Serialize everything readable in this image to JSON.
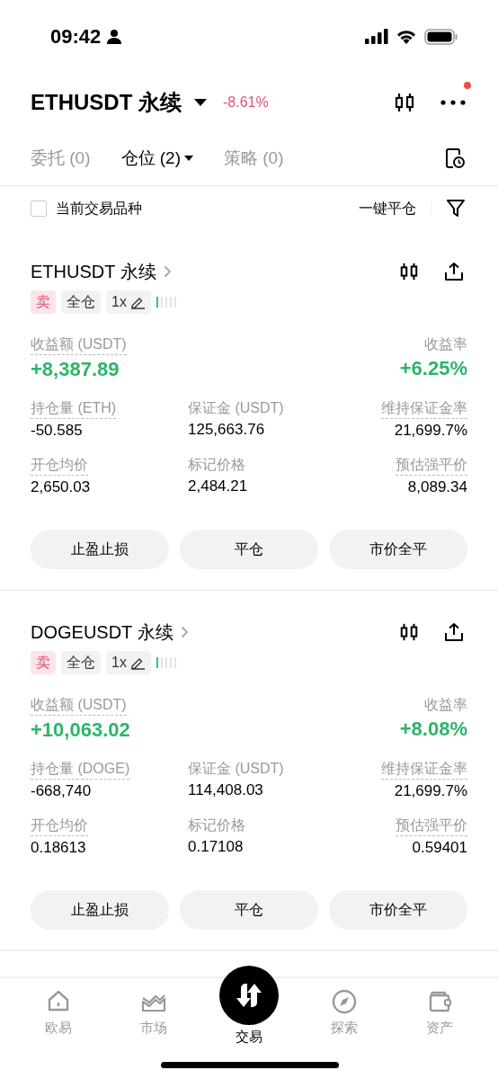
{
  "status_bar": {
    "time": "09:42"
  },
  "header": {
    "symbol": "ETHUSDT 永续",
    "change": "-8.61%",
    "notification_dot": true
  },
  "tabs": [
    {
      "label": "委托 (0)",
      "selected": false,
      "dropdown": false
    },
    {
      "label": "仓位 (2)",
      "selected": true,
      "dropdown": true
    },
    {
      "label": "策略 (0)",
      "selected": false,
      "dropdown": false
    }
  ],
  "filter": {
    "label": "当前交易品种",
    "checked": false,
    "close_all": "一键平仓"
  },
  "positions": [
    {
      "name": "ETHUSDT 永续",
      "side": {
        "kind": "sell",
        "label": "卖"
      },
      "margin_mode": "全仓",
      "leverage": "1x",
      "level": 0.2,
      "pnl_label": "收益额 (USDT)",
      "pnl": "+8,387.89",
      "rate_label": "收益率",
      "rate": "+6.25%",
      "fields": [
        {
          "label": "持仓量 (ETH)",
          "value": "-50.585",
          "hint": true
        },
        {
          "label": "保证金 (USDT)",
          "value": "125,663.76",
          "hint": false
        },
        {
          "label": "维持保证金率",
          "value": "21,699.7%",
          "hint": true
        },
        {
          "label": "开仓均价",
          "value": "2,650.03",
          "hint": true
        },
        {
          "label": "标记价格",
          "value": "2,484.21",
          "hint": false
        },
        {
          "label": "预估强平价",
          "value": "8,089.34",
          "hint": true
        }
      ],
      "buttons": [
        "止盈止损",
        "平仓",
        "市价全平"
      ]
    },
    {
      "name": "DOGEUSDT 永续",
      "side": {
        "kind": "sell",
        "label": "卖"
      },
      "margin_mode": "全仓",
      "leverage": "1x",
      "level": 0.2,
      "pnl_label": "收益额 (USDT)",
      "pnl": "+10,063.02",
      "rate_label": "收益率",
      "rate": "+8.08%",
      "fields": [
        {
          "label": "持仓量 (DOGE)",
          "value": "-668,740",
          "hint": true
        },
        {
          "label": "保证金 (USDT)",
          "value": "114,408.03",
          "hint": false
        },
        {
          "label": "维持保证金率",
          "value": "21,699.7%",
          "hint": true
        },
        {
          "label": "开仓均价",
          "value": "0.18613",
          "hint": true
        },
        {
          "label": "标记价格",
          "value": "0.17108",
          "hint": false
        },
        {
          "label": "预估强平价",
          "value": "0.59401",
          "hint": true
        }
      ],
      "buttons": [
        "止盈止损",
        "平仓",
        "市价全平"
      ]
    }
  ],
  "nav": [
    {
      "kind": "home",
      "label": "欧易",
      "selected": false
    },
    {
      "kind": "market",
      "label": "市场",
      "selected": false
    },
    {
      "kind": "trade",
      "label": "交易",
      "selected": true
    },
    {
      "kind": "explore",
      "label": "探索",
      "selected": false
    },
    {
      "kind": "assets",
      "label": "资产",
      "selected": false
    }
  ]
}
